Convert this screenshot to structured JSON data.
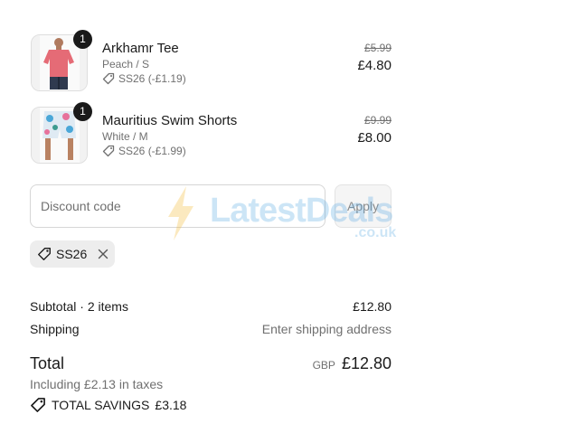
{
  "items": [
    {
      "name": "Arkhamr Tee",
      "variant": "Peach / S",
      "discount": "SS26 (-£1.19)",
      "original_price": "£5.99",
      "price": "£4.80",
      "quantity": "1"
    },
    {
      "name": "Mauritius Swim Shorts",
      "variant": "White / M",
      "discount": "SS26 (-£1.99)",
      "original_price": "£9.99",
      "price": "£8.00",
      "quantity": "1"
    }
  ],
  "discount": {
    "placeholder": "Discount code",
    "apply_label": "Apply",
    "applied_code": "SS26"
  },
  "watermark": {
    "text": "LatestDeals",
    "sub": ".co.uk"
  },
  "summary": {
    "subtotal_label": "Subtotal · 2 items",
    "subtotal_value": "£12.80",
    "shipping_label": "Shipping",
    "shipping_value": "Enter shipping address",
    "total_label": "Total",
    "currency": "GBP",
    "total_value": "£12.80",
    "taxes_note": "Including £2.13 in taxes",
    "savings_label": "TOTAL SAVINGS",
    "savings_value": "£3.18"
  },
  "colors": {
    "text": "#1a1a1a",
    "muted": "#707070",
    "badge": "#1a1a1a",
    "tee": "#e56b76",
    "chip_bg": "#ededed"
  }
}
